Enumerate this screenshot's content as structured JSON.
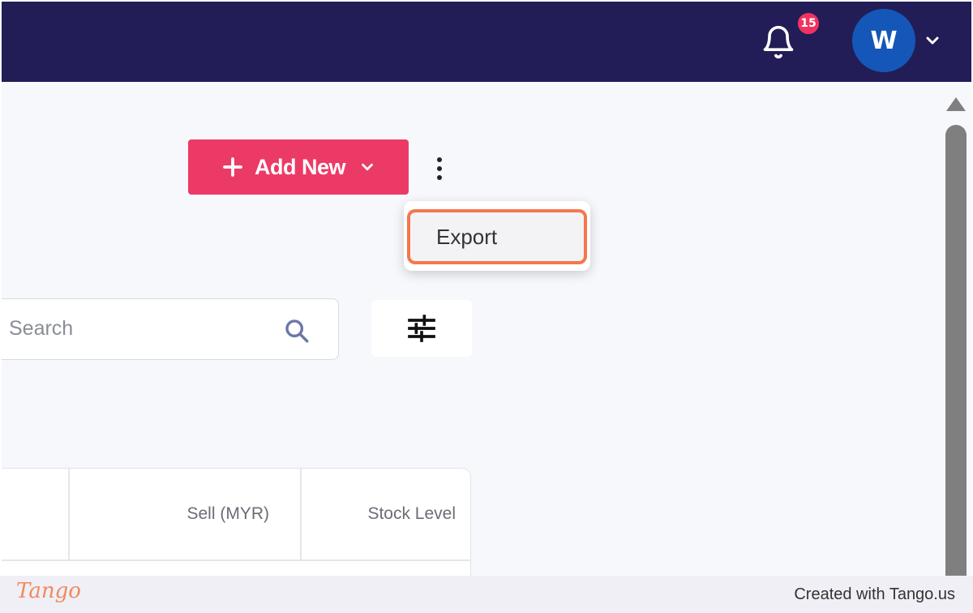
{
  "header": {
    "notification_count": "15",
    "avatar_initial": "W"
  },
  "toolbar": {
    "add_new_label": "Add New"
  },
  "more_menu": {
    "items": [
      {
        "label": "Export",
        "highlighted": true
      }
    ]
  },
  "search": {
    "placeholder": "Search",
    "value": ""
  },
  "table": {
    "columns": [
      "",
      "Sell (MYR)",
      "Stock Level"
    ]
  },
  "footer": {
    "brand": "Tango",
    "credit": "Created with Tango.us"
  },
  "colors": {
    "topbar": "#221d57",
    "accent": "#ec3a66",
    "badge": "#ef3361",
    "avatar": "#1557b8",
    "highlight_outline": "#f5774d"
  },
  "icons": [
    "bell-icon",
    "chevron-down-icon",
    "plus-icon",
    "more-vertical-icon",
    "search-icon",
    "sliders-icon",
    "scroll-up-arrow-icon"
  ]
}
